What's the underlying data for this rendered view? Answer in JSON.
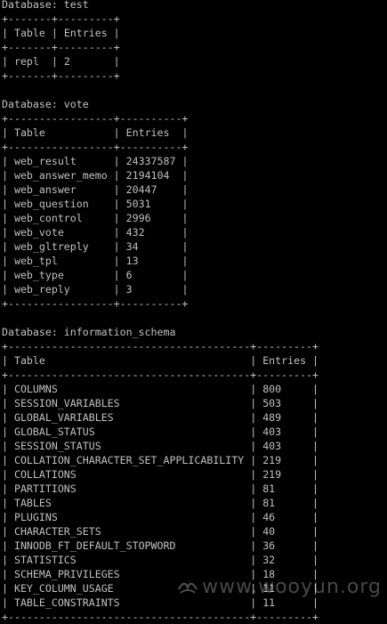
{
  "window": {
    "type": "terminal",
    "background": "#000000",
    "foreground": "#c0c0c0"
  },
  "sections": [
    {
      "title": "Database: test",
      "header": {
        "table": "Table",
        "entries": "Entries"
      },
      "rows": [
        {
          "table": "repl",
          "entries": "2"
        }
      ]
    },
    {
      "title": "Database: vote",
      "header": {
        "table": "Table",
        "entries": "Entries"
      },
      "rows": [
        {
          "table": "web_result",
          "entries": "24337587"
        },
        {
          "table": "web_answer_memo",
          "entries": "2194104"
        },
        {
          "table": "web_answer",
          "entries": "20447"
        },
        {
          "table": "web_question",
          "entries": "5031"
        },
        {
          "table": "web_control",
          "entries": "2996"
        },
        {
          "table": "web_vote",
          "entries": "432"
        },
        {
          "table": "web_gltreply",
          "entries": "34"
        },
        {
          "table": "web_tpl",
          "entries": "13"
        },
        {
          "table": "web_type",
          "entries": "6"
        },
        {
          "table": "web_reply",
          "entries": "3"
        }
      ]
    },
    {
      "title": "Database: information_schema",
      "header": {
        "table": "Table",
        "entries": "Entries"
      },
      "rows": [
        {
          "table": "COLUMNS",
          "entries": "800"
        },
        {
          "table": "SESSION_VARIABLES",
          "entries": "503"
        },
        {
          "table": "GLOBAL_VARIABLES",
          "entries": "489"
        },
        {
          "table": "GLOBAL_STATUS",
          "entries": "403"
        },
        {
          "table": "SESSION_STATUS",
          "entries": "403"
        },
        {
          "table": "COLLATION_CHARACTER_SET_APPLICABILITY",
          "entries": "219"
        },
        {
          "table": "COLLATIONS",
          "entries": "219"
        },
        {
          "table": "PARTITIONS",
          "entries": "81"
        },
        {
          "table": "TABLES",
          "entries": "81"
        },
        {
          "table": "PLUGINS",
          "entries": "46"
        },
        {
          "table": "CHARACTER_SETS",
          "entries": "40"
        },
        {
          "table": "INNODB_FT_DEFAULT_STOPWORD",
          "entries": "36"
        },
        {
          "table": "STATISTICS",
          "entries": "32"
        },
        {
          "table": "SCHEMA_PRIVILEGES",
          "entries": "18"
        },
        {
          "table": "KEY_COLUMN_USAGE",
          "entries": "11"
        },
        {
          "table": "TABLE_CONSTRAINTS",
          "entries": "11"
        }
      ]
    }
  ],
  "watermark": "www.wooyun.org"
}
